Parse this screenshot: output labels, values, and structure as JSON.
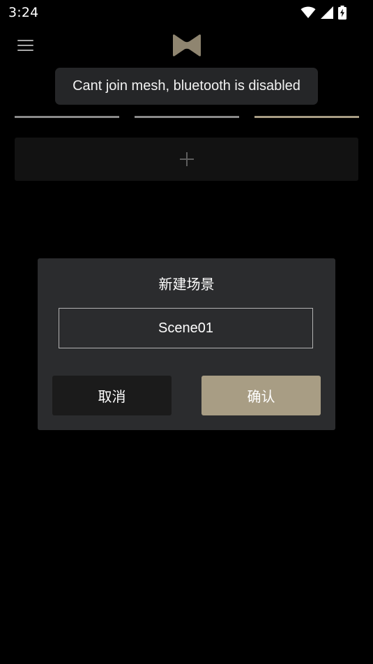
{
  "status_bar": {
    "time": "3:24",
    "icons": [
      "wifi-icon",
      "cellular-signal-icon",
      "battery-charging-icon"
    ]
  },
  "header": {
    "menu_icon": "hamburger-menu-icon",
    "logo_icon": "brand-logo-icon"
  },
  "colors": {
    "background": "#000000",
    "accent": "#a89d84",
    "tab_inactive": "#8a8a8a",
    "tab_active": "#a89d84",
    "dialog_bg": "#2b2c2e",
    "toast_bg": "#252628"
  },
  "toast": {
    "message": "Cant join mesh, bluetooth is disabled"
  },
  "add_tile": {
    "icon": "plus-icon"
  },
  "dialog": {
    "title": "新建场景",
    "input_value": "Scene01",
    "cancel_label": "取消",
    "confirm_label": "确认"
  }
}
